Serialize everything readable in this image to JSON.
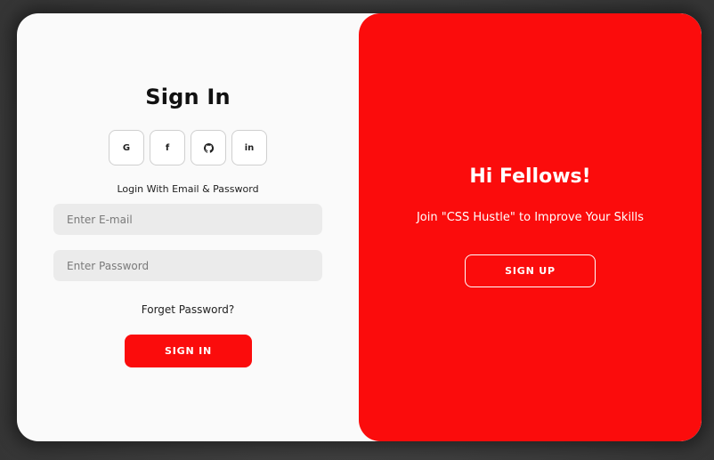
{
  "sign_in": {
    "title": "Sign In",
    "social": [
      {
        "label": "G",
        "icon": "google-icon"
      },
      {
        "label": "f",
        "icon": "facebook-icon"
      },
      {
        "label": "",
        "icon": "github-icon"
      },
      {
        "label": "in",
        "icon": "linkedin-icon"
      }
    ],
    "caption": "Login With Email & Password",
    "email_placeholder": "Enter E-mail",
    "password_placeholder": "Enter Password",
    "forget_label": "Forget Password?",
    "submit_label": "SIGN IN"
  },
  "welcome": {
    "heading": "Hi Fellows!",
    "message": "Join \"CSS Hustle\" to Improve Your Skills",
    "signup_label": "SIGN UP"
  },
  "colors": {
    "accent": "#fb0c0c",
    "page_background": "#3e3e3e",
    "card_background": "#fafafa",
    "input_background": "#ebebeb"
  }
}
